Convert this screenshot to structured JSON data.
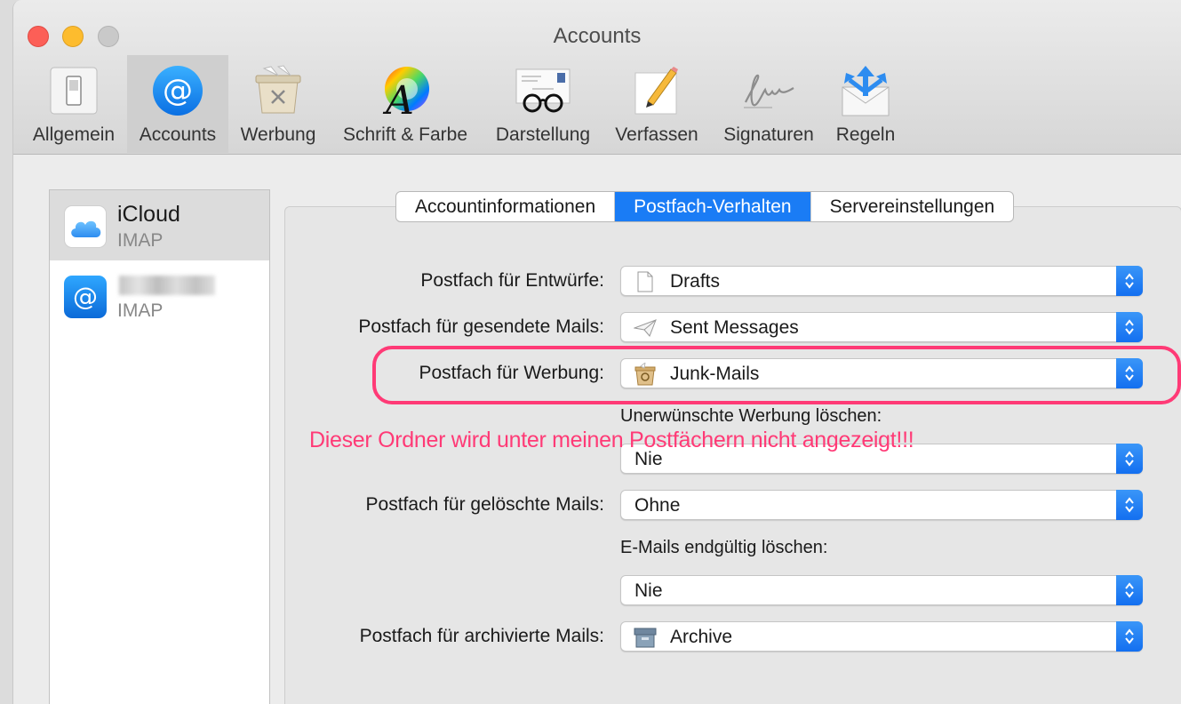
{
  "window": {
    "title": "Accounts"
  },
  "toolbar": {
    "items": [
      {
        "label": "Allgemein",
        "icon": "switch-icon"
      },
      {
        "label": "Accounts",
        "icon": "at-icon",
        "selected": true
      },
      {
        "label": "Werbung",
        "icon": "junk-bin-icon"
      },
      {
        "label": "Schrift & Farbe",
        "icon": "font-color-icon"
      },
      {
        "label": "Darstellung",
        "icon": "glasses-letter-icon"
      },
      {
        "label": "Verfassen",
        "icon": "pencil-paper-icon"
      },
      {
        "label": "Signaturen",
        "icon": "signature-icon"
      },
      {
        "label": "Regeln",
        "icon": "rules-envelope-icon"
      }
    ]
  },
  "sidebar": {
    "accounts": [
      {
        "name": "iCloud",
        "type": "IMAP",
        "icon": "icloud-icon",
        "selected": true
      },
      {
        "name": "",
        "type": "IMAP",
        "icon": "at-icon"
      }
    ]
  },
  "tabs": [
    {
      "label": "Accountinformationen"
    },
    {
      "label": "Postfach-Verhalten",
      "active": true
    },
    {
      "label": "Servereinstellungen"
    }
  ],
  "form": {
    "drafts_label": "Postfach für Entwürfe:",
    "drafts_value": "Drafts",
    "sent_label": "Postfach für gesendete Mails:",
    "sent_value": "Sent Messages",
    "junk_label": "Postfach für Werbung:",
    "junk_value": "Junk-Mails",
    "junk_delete_label": "Unerwünschte Werbung löschen:",
    "junk_delete_value": "Nie",
    "trash_label": "Postfach für gelöschte Mails:",
    "trash_value": "Ohne",
    "erase_label": "E-Mails endgültig löschen:",
    "erase_value": "Nie",
    "archive_label": "Postfach für archivierte Mails:",
    "archive_value": "Archive"
  },
  "annotation": {
    "text": "Dieser Ordner wird unter meinen Postfächern nicht angezeigt!!!",
    "color": "#ff3a76"
  },
  "colors": {
    "accent": "#1a7cf5"
  }
}
